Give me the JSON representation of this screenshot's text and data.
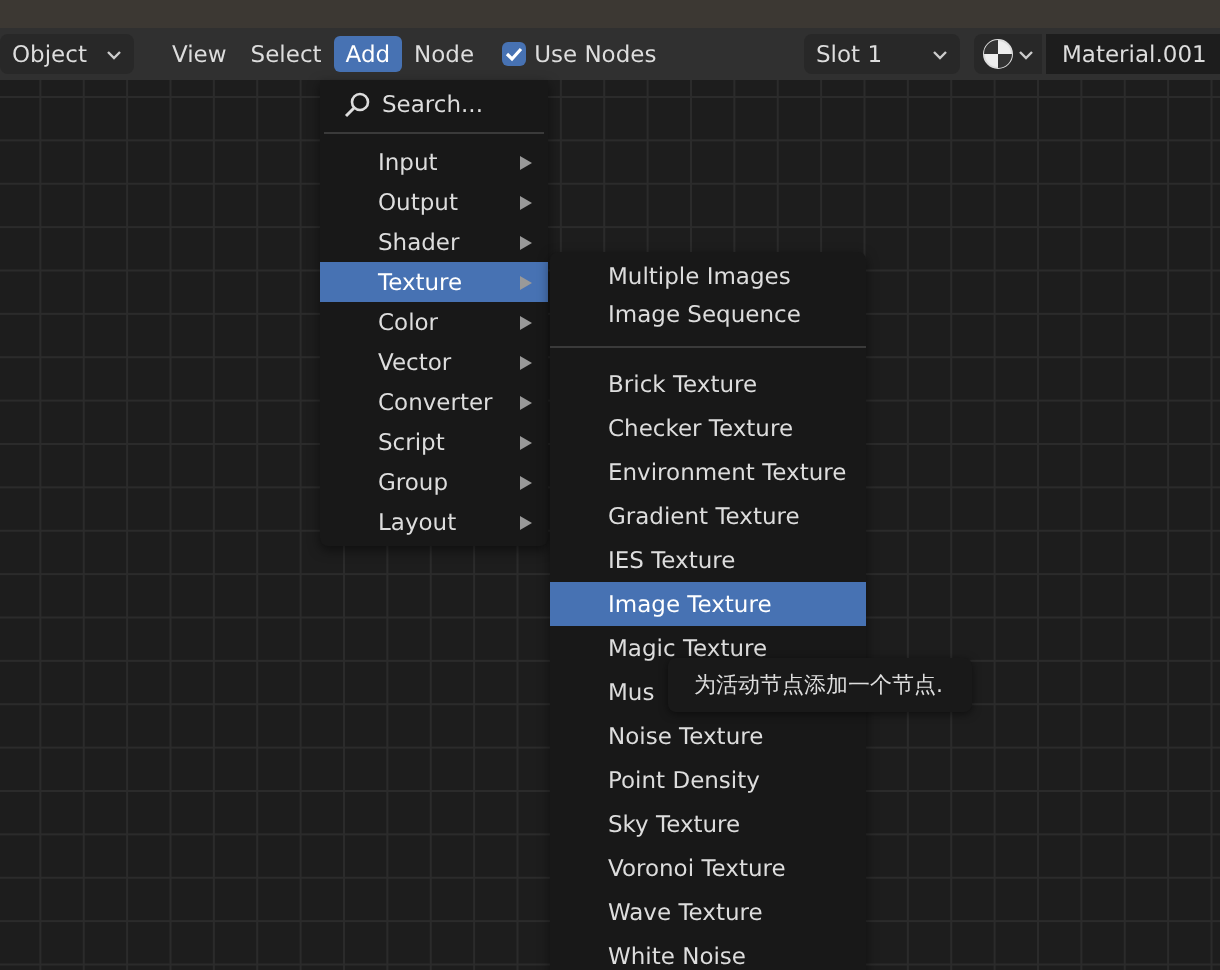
{
  "header": {
    "mode_dropdown": "Object",
    "menus": [
      {
        "label": "View",
        "selected": false
      },
      {
        "label": "Select",
        "selected": false
      },
      {
        "label": "Add",
        "selected": true
      },
      {
        "label": "Node",
        "selected": false
      }
    ],
    "use_nodes": {
      "label": "Use Nodes",
      "checked": true
    },
    "slot_dropdown": "Slot 1",
    "material_field": "Material.001"
  },
  "add_menu": {
    "search": "Search...",
    "items": [
      {
        "label": "Input",
        "selected": false
      },
      {
        "label": "Output",
        "selected": false
      },
      {
        "label": "Shader",
        "selected": false
      },
      {
        "label": "Texture",
        "selected": true
      },
      {
        "label": "Color",
        "selected": false
      },
      {
        "label": "Vector",
        "selected": false
      },
      {
        "label": "Converter",
        "selected": false
      },
      {
        "label": "Script",
        "selected": false
      },
      {
        "label": "Group",
        "selected": false
      },
      {
        "label": "Layout",
        "selected": false
      }
    ]
  },
  "texture_menu": {
    "groups": [
      [
        {
          "label": "Multiple Images",
          "selected": false
        },
        {
          "label": "Image Sequence",
          "selected": false
        }
      ],
      [
        {
          "label": "Brick Texture",
          "selected": false
        },
        {
          "label": "Checker Texture",
          "selected": false
        },
        {
          "label": "Environment Texture",
          "selected": false
        },
        {
          "label": "Gradient Texture",
          "selected": false
        },
        {
          "label": "IES Texture",
          "selected": false
        },
        {
          "label": "Image Texture",
          "selected": true
        },
        {
          "label": "Magic Texture",
          "selected": false
        },
        {
          "label": "Mus",
          "selected": false
        },
        {
          "label": "Noise Texture",
          "selected": false
        },
        {
          "label": "Point Density",
          "selected": false
        },
        {
          "label": "Sky Texture",
          "selected": false
        },
        {
          "label": "Voronoi Texture",
          "selected": false
        },
        {
          "label": "Wave Texture",
          "selected": false
        },
        {
          "label": "White Noise",
          "selected": false
        }
      ]
    ]
  },
  "tooltip": "为活动节点添加一个节点."
}
